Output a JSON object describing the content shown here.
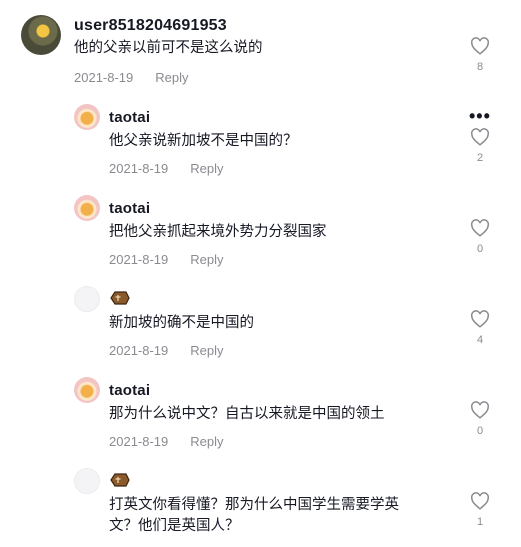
{
  "comments": [
    {
      "user": "user8518204691953",
      "text": "他的父亲以前可不是这么说的",
      "date": "2021-8-19",
      "reply": "Reply",
      "likes": "8"
    },
    {
      "user": "taotai",
      "text": "他父亲说新加坡不是中国的？",
      "date": "2021-8-19",
      "reply": "Reply",
      "likes": "2"
    },
    {
      "user": "taotai",
      "text": "把他父亲抓起来境外势力分裂国家",
      "date": "2021-8-19",
      "reply": "Reply",
      "likes": "0"
    },
    {
      "user": "⚰️",
      "text": "新加坡的确不是中国的",
      "date": "2021-8-19",
      "reply": "Reply",
      "likes": "4"
    },
    {
      "user": "taotai",
      "text": "那为什么说中文？自古以来就是中国的领土",
      "date": "2021-8-19",
      "reply": "Reply",
      "likes": "0"
    },
    {
      "user": "⚰️",
      "text_line1": "打英文你看得懂？那为什么中国学生需要学英",
      "text_line2": "文？他们是英国人？",
      "likes": "1"
    }
  ],
  "icons": {
    "like": "heart-outline-icon",
    "more": "more-options-icon",
    "coffin": "coffin-emoji"
  }
}
